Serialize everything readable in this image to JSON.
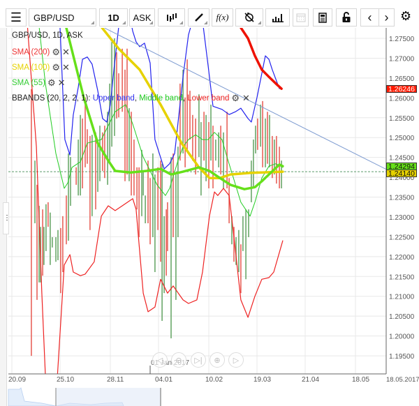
{
  "toolbar": {
    "symbol": "GBP/USD",
    "timeframe": "1D",
    "price_type": "ASK",
    "fx_label": "f(x)"
  },
  "legend": {
    "title": "GBP/USD, 1D, ASK",
    "sma200": "SMA (200)",
    "sma100": "SMA (100)",
    "sma55": "SMA (55)",
    "bbands": "BBANDS (20, 2, 2, 1):",
    "upper": "Upper band",
    "sep1": ",",
    "middle": "Middle band",
    "sep2": ",",
    "lower": "Lower band"
  },
  "price_labels": {
    "sma200": "1.26246",
    "sma55": "1.24294",
    "sma100": "1.24140"
  },
  "date_marker": "01 Jan 2017",
  "end_date": "18.05.2017",
  "colors": {
    "up": "#6aa86a",
    "down": "#e8625a",
    "upper": "#2222ee",
    "middle": "#22cc22",
    "lower": "#ee2222",
    "sma200": "#ee1100",
    "sma100": "#e6d200",
    "sma55": "#66e01a",
    "trend": "#7c9ad0"
  },
  "chart_data": {
    "type": "line",
    "ylim": [
      1.1927,
      1.2776
    ],
    "yticks": [
      "1.27500",
      "1.27000",
      "1.26500",
      "1.26000",
      "1.25500",
      "1.25000",
      "1.24500",
      "1.24000",
      "1.23500",
      "1.23000",
      "1.22500",
      "1.22000",
      "1.21500",
      "1.21000",
      "1.20500",
      "1.20000",
      "1.19500"
    ],
    "xticks": [
      {
        "i": 0,
        "label": "20.09"
      },
      {
        "i": 23,
        "label": "25.10"
      },
      {
        "i": 47,
        "label": "28.11"
      },
      {
        "i": 70,
        "label": "04.01"
      },
      {
        "i": 94,
        "label": "10.02"
      },
      {
        "i": 117,
        "label": "19.03"
      },
      {
        "i": 140,
        "label": "21.04"
      },
      {
        "i": 164,
        "label": "18.05"
      }
    ],
    "last_price": 1.2414,
    "bars": [
      [
        9.3,
        1.2622,
        1.195,
        0
      ],
      [
        11,
        1.2442,
        1.2284,
        1
      ],
      [
        12,
        1.2381,
        1.2091,
        0
      ],
      [
        13,
        1.2328,
        1.2135,
        1
      ],
      [
        13.7,
        1.2275,
        1.2135,
        1
      ],
      [
        14.7,
        1.2319,
        1.2152,
        0
      ],
      [
        15.3,
        1.2275,
        1.2179,
        1
      ],
      [
        16.3,
        1.2332,
        1.2214,
        1
      ],
      [
        17.3,
        1.2337,
        1.2275,
        0
      ],
      [
        18.3,
        1.2311,
        1.2179,
        1
      ],
      [
        19.3,
        1.2249,
        1.2223,
        1
      ],
      [
        21,
        1.2249,
        1.2187,
        1
      ],
      [
        22,
        1.2267,
        1.2191,
        1
      ],
      [
        23.3,
        1.2272,
        1.2108,
        0
      ],
      [
        24.3,
        1.2302,
        1.2161,
        0
      ],
      [
        26,
        1.2354,
        1.2231,
        0
      ],
      [
        27,
        1.246,
        1.224,
        1
      ],
      [
        28,
        1.2451,
        1.2328,
        1
      ],
      [
        30.7,
        1.2425,
        1.2381,
        0
      ],
      [
        31.7,
        1.2495,
        1.2354,
        1
      ],
      [
        32.7,
        1.2557,
        1.2354,
        1
      ],
      [
        33.7,
        1.2548,
        1.2372,
        0
      ],
      [
        35,
        1.2601,
        1.2425,
        0
      ],
      [
        36,
        1.2521,
        1.2434,
        0
      ],
      [
        37.3,
        1.2504,
        1.2267,
        0
      ],
      [
        38.3,
        1.2507,
        1.2302,
        1
      ],
      [
        40,
        1.2513,
        1.2319,
        0
      ],
      [
        41,
        1.2495,
        1.2363,
        1
      ],
      [
        42,
        1.253,
        1.239,
        1
      ],
      [
        43.3,
        1.2513,
        1.2416,
        0
      ],
      [
        44.3,
        1.253,
        1.2398,
        0
      ],
      [
        45.7,
        1.2565,
        1.2381,
        1
      ],
      [
        46.7,
        1.2636,
        1.2442,
        1
      ],
      [
        47.7,
        1.2741,
        1.2477,
        1
      ],
      [
        49,
        1.275,
        1.2504,
        1
      ],
      [
        50,
        1.2715,
        1.2548,
        0
      ],
      [
        51,
        1.2662,
        1.2551,
        0
      ],
      [
        52.7,
        1.2724,
        1.2565,
        0
      ],
      [
        54,
        1.2671,
        1.239,
        0
      ],
      [
        55,
        1.2724,
        1.2407,
        0
      ],
      [
        56,
        1.2574,
        1.239,
        1
      ],
      [
        57,
        1.2565,
        1.2354,
        0
      ],
      [
        58.3,
        1.2495,
        1.2354,
        0
      ],
      [
        59.7,
        1.2425,
        1.2319,
        0
      ],
      [
        60.7,
        1.2425,
        1.2249,
        0
      ],
      [
        62,
        1.2469,
        1.2302,
        1
      ],
      [
        62.7,
        1.2416,
        1.2354,
        1
      ],
      [
        63.7,
        1.2354,
        1.2284,
        1
      ],
      [
        65,
        1.2442,
        1.2284,
        0
      ],
      [
        66,
        1.2398,
        1.2231,
        0
      ],
      [
        67.3,
        1.246,
        1.2249,
        1
      ],
      [
        68.3,
        1.2407,
        1.2161,
        1
      ],
      [
        69.7,
        1.2425,
        1.2267,
        0
      ],
      [
        71,
        1.2442,
        1.2187,
        0
      ],
      [
        71.7,
        1.2434,
        1.2038,
        1
      ],
      [
        72.7,
        1.2302,
        1.2108,
        1
      ],
      [
        73.7,
        1.2319,
        1.2152,
        0
      ],
      [
        74.3,
        1.2337,
        1.2214,
        0
      ],
      [
        76,
        1.2451,
        1.1994,
        1
      ],
      [
        77,
        1.246,
        1.2249,
        0
      ],
      [
        78.3,
        1.2407,
        1.2091,
        1
      ],
      [
        79.3,
        1.2477,
        1.2249,
        1
      ],
      [
        80.3,
        1.2636,
        1.2442,
        0
      ],
      [
        81.7,
        1.2671,
        1.246,
        1
      ],
      [
        82.7,
        1.2601,
        1.2425,
        0
      ],
      [
        83.7,
        1.2697,
        1.2469,
        0
      ],
      [
        85,
        1.2618,
        1.2495,
        0
      ],
      [
        86.3,
        1.2557,
        1.2442,
        0
      ],
      [
        87.7,
        1.2548,
        1.2407,
        0
      ],
      [
        89.3,
        1.2609,
        1.2451,
        1
      ],
      [
        90.3,
        1.2539,
        1.2354,
        1
      ],
      [
        91.7,
        1.2565,
        1.2442,
        0
      ],
      [
        92.7,
        1.2557,
        1.239,
        1
      ],
      [
        94,
        1.2539,
        1.2372,
        0
      ],
      [
        95,
        1.2583,
        1.2442,
        1
      ],
      [
        96,
        1.253,
        1.2372,
        0
      ],
      [
        97.3,
        1.2495,
        1.2442,
        1
      ],
      [
        98.7,
        1.2513,
        1.2425,
        1
      ],
      [
        99.7,
        1.253,
        1.2407,
        0
      ],
      [
        101,
        1.2513,
        1.2372,
        1
      ],
      [
        102.7,
        1.2565,
        1.2372,
        0
      ],
      [
        103.7,
        1.2398,
        1.2284,
        0
      ],
      [
        105,
        1.2302,
        1.2231,
        1
      ],
      [
        106,
        1.2275,
        1.2187,
        0
      ],
      [
        107,
        1.2249,
        1.2179,
        1
      ],
      [
        108.3,
        1.2267,
        1.2161,
        1
      ],
      [
        109.3,
        1.2231,
        1.2108,
        0
      ],
      [
        110.3,
        1.2302,
        1.2214,
        1
      ],
      [
        111.7,
        1.2319,
        1.2143,
        1
      ],
      [
        113,
        1.2319,
        1.2249,
        1
      ],
      [
        114.3,
        1.2442,
        1.2337,
        1
      ],
      [
        115.3,
        1.2495,
        1.2372,
        1
      ],
      [
        116.3,
        1.253,
        1.246,
        1
      ],
      [
        117.3,
        1.2548,
        1.2469,
        0
      ],
      [
        118.7,
        1.2583,
        1.2477,
        1
      ],
      [
        119.7,
        1.2592,
        1.2425,
        0
      ],
      [
        121,
        1.2548,
        1.2425,
        1
      ],
      [
        122,
        1.2565,
        1.2434,
        0
      ],
      [
        123,
        1.2557,
        1.2425,
        1
      ],
      [
        124.3,
        1.2504,
        1.2398,
        0
      ],
      [
        125.3,
        1.2495,
        1.2407,
        1
      ],
      [
        126.3,
        1.2504,
        1.2384,
        0
      ],
      [
        127.7,
        1.2477,
        1.2372,
        0
      ],
      [
        128.7,
        1.2442,
        1.2372,
        1
      ]
    ],
    "series": [
      {
        "name": "Upper band",
        "key": "upper",
        "width": 1.2,
        "points": [
          [
            23,
            1.2776
          ],
          [
            25.3,
            1.2495
          ],
          [
            27.7,
            1.2456
          ],
          [
            29.3,
            1.2557
          ],
          [
            31.7,
            1.2627
          ],
          [
            33.7,
            1.2697
          ],
          [
            36,
            1.2703
          ],
          [
            38.3,
            1.2685
          ],
          [
            41,
            1.2618
          ],
          [
            43.3,
            1.2548
          ],
          [
            45.3,
            1.2539
          ],
          [
            47,
            1.2583
          ],
          [
            48.7,
            1.2671
          ],
          [
            51.7,
            1.2812
          ],
          [
            56,
            1.2812
          ],
          [
            57.7,
            1.2768
          ],
          [
            59.3,
            1.2741
          ],
          [
            61,
            1.2729
          ],
          [
            63.3,
            1.2738
          ],
          [
            66,
            1.2688
          ],
          [
            68.3,
            1.2495
          ],
          [
            72.7,
            1.2421
          ],
          [
            75.3,
            1.2434
          ],
          [
            77.7,
            1.246
          ],
          [
            81.7,
            1.2653
          ],
          [
            84.3,
            1.2759
          ],
          [
            86.7,
            1.2803
          ],
          [
            91,
            1.2794
          ],
          [
            93.7,
            1.268
          ],
          [
            96,
            1.2579
          ],
          [
            100.3,
            1.2571
          ],
          [
            103.7,
            1.2558
          ],
          [
            106.7,
            1.2565
          ],
          [
            109.3,
            1.2574
          ],
          [
            112.7,
            1.2548
          ],
          [
            114.3,
            1.2539
          ],
          [
            117,
            1.2601
          ],
          [
            121,
            1.2706
          ],
          [
            122.7,
            1.2697
          ],
          [
            124.3,
            1.2671
          ],
          [
            127.7,
            1.2623
          ]
        ]
      },
      {
        "name": "Middle band",
        "key": "middle",
        "width": 1,
        "points": [
          [
            12.7,
            1.2794
          ],
          [
            16,
            1.2636
          ],
          [
            21,
            1.246
          ],
          [
            25,
            1.2372
          ],
          [
            26.7,
            1.2386
          ],
          [
            28.7,
            1.2425
          ],
          [
            32.7,
            1.2439
          ],
          [
            36,
            1.2486
          ],
          [
            38.7,
            1.249
          ],
          [
            42.7,
            1.2495
          ],
          [
            46,
            1.253
          ],
          [
            49.3,
            1.2565
          ],
          [
            54.3,
            1.2583
          ],
          [
            57.7,
            1.2534
          ],
          [
            62.7,
            1.2451
          ],
          [
            66,
            1.2416
          ],
          [
            69.3,
            1.2381
          ],
          [
            73.3,
            1.2354
          ],
          [
            75.3,
            1.2372
          ],
          [
            79.3,
            1.2442
          ],
          [
            81.7,
            1.2477
          ],
          [
            84.3,
            1.2495
          ],
          [
            87.7,
            1.2507
          ],
          [
            91,
            1.2495
          ],
          [
            93.7,
            1.2495
          ],
          [
            96.7,
            1.2513
          ],
          [
            100.3,
            1.2495
          ],
          [
            102.7,
            1.2451
          ],
          [
            109.3,
            1.2337
          ],
          [
            113.7,
            1.2302
          ],
          [
            116,
            1.2337
          ],
          [
            119.3,
            1.2398
          ],
          [
            122.7,
            1.2428
          ],
          [
            126,
            1.2434
          ],
          [
            129.3,
            1.2425
          ]
        ]
      },
      {
        "name": "Lower band",
        "key": "lower",
        "width": 1.2,
        "points": [
          [
            7,
            1.2812
          ],
          [
            11.7,
            1.2477
          ],
          [
            14.3,
            1.2108
          ],
          [
            16.3,
            1.1862
          ],
          [
            19.3,
            1.1757
          ],
          [
            21.7,
            1.1897
          ],
          [
            25,
            1.2179
          ],
          [
            27.7,
            1.2205
          ],
          [
            29.3,
            1.2161
          ],
          [
            32.7,
            1.2152
          ],
          [
            35,
            1.2156
          ],
          [
            39.3,
            1.2187
          ],
          [
            42.7,
            1.2302
          ],
          [
            46,
            1.2328
          ],
          [
            49.3,
            1.2316
          ],
          [
            52.7,
            1.2328
          ],
          [
            57.7,
            1.2346
          ],
          [
            59.3,
            1.2319
          ],
          [
            62.7,
            1.2108
          ],
          [
            65,
            1.2061
          ],
          [
            68.3,
            1.2073
          ],
          [
            71,
            1.2143
          ],
          [
            74.3,
            1.2108
          ],
          [
            77,
            1.2126
          ],
          [
            81.7,
            1.2091
          ],
          [
            84.3,
            1.2082
          ],
          [
            88.3,
            1.2091
          ],
          [
            91,
            1.2161
          ],
          [
            94.3,
            1.2302
          ],
          [
            96.7,
            1.2363
          ],
          [
            98.3,
            1.2354
          ],
          [
            101,
            1.2372
          ],
          [
            103.7,
            1.2354
          ],
          [
            106,
            1.2249
          ],
          [
            109.3,
            1.2091
          ],
          [
            112.7,
            1.2047
          ],
          [
            116,
            1.21
          ],
          [
            119.3,
            1.2143
          ],
          [
            122.7,
            1.2147
          ],
          [
            125,
            1.2161
          ],
          [
            129.3,
            1.224
          ]
        ]
      },
      {
        "name": "SMA (100)",
        "key": "sma100",
        "width": 3.5,
        "points": [
          [
            37.7,
            1.2812
          ],
          [
            51,
            1.2724
          ],
          [
            61,
            1.2671
          ],
          [
            71,
            1.2583
          ],
          [
            81,
            1.2486
          ],
          [
            89.3,
            1.2425
          ],
          [
            94.3,
            1.2398
          ],
          [
            99.3,
            1.2398
          ],
          [
            104.3,
            1.2407
          ],
          [
            114.3,
            1.2411
          ],
          [
            129.3,
            1.2414
          ]
        ]
      },
      {
        "name": "SMA (55)",
        "key": "sma55",
        "width": 3.5,
        "points": [
          [
            24.3,
            1.2812
          ],
          [
            34.3,
            1.2601
          ],
          [
            41,
            1.2486
          ],
          [
            46,
            1.2442
          ],
          [
            49.3,
            1.2416
          ],
          [
            56.7,
            1.2412
          ],
          [
            64.3,
            1.2416
          ],
          [
            71,
            1.2421
          ],
          [
            76,
            1.2407
          ],
          [
            81.7,
            1.2414
          ],
          [
            89.3,
            1.2425
          ],
          [
            94.3,
            1.2416
          ],
          [
            99.3,
            1.2398
          ],
          [
            104.3,
            1.2381
          ],
          [
            111,
            1.237
          ],
          [
            116,
            1.2375
          ],
          [
            119.3,
            1.239
          ],
          [
            122.7,
            1.2407
          ],
          [
            127.7,
            1.2432
          ],
          [
            129.3,
            1.2428
          ]
        ]
      },
      {
        "name": "SMA (200)",
        "key": "sma200",
        "width": 3.5,
        "points": [
          [
            106,
            1.2803
          ],
          [
            112.7,
            1.275
          ],
          [
            116,
            1.2706
          ],
          [
            119.3,
            1.2671
          ],
          [
            122.7,
            1.2653
          ],
          [
            126,
            1.2636
          ],
          [
            128.7,
            1.2623
          ]
        ]
      },
      {
        "name": "Trend line",
        "key": "trend",
        "width": 1,
        "points": [
          [
            44.3,
            1.2776
          ],
          [
            178.7,
            1.242
          ]
        ]
      }
    ]
  }
}
